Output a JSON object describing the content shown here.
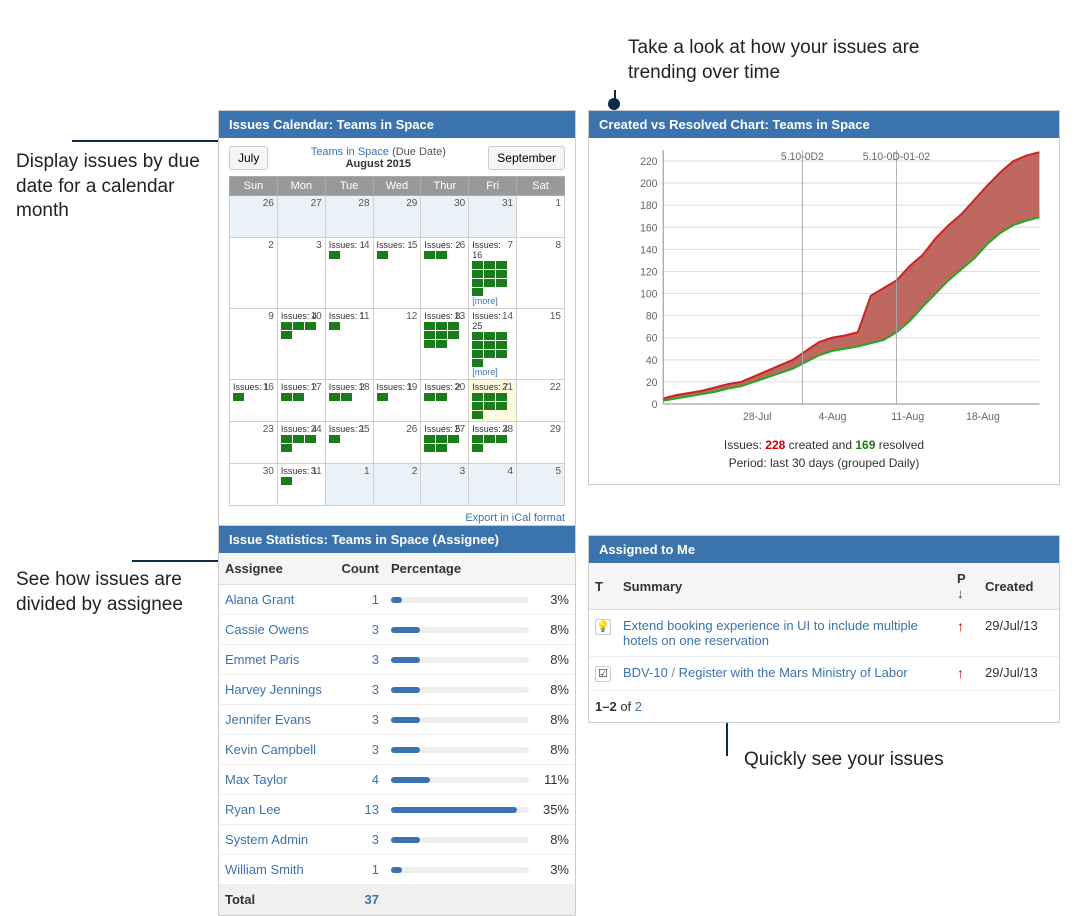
{
  "annotations": {
    "a1": "Display issues by due date for a calendar month",
    "a2": "Take a look at how your issues are trending over time",
    "a3": "See how issues are divided by assignee",
    "a4": "Quickly see your issues"
  },
  "calendar": {
    "header": "Issues Calendar: Teams in Space",
    "project_link": "Teams in Space",
    "due_label": "(Due Date)",
    "month": "August 2015",
    "prev_btn": "July",
    "next_btn": "September",
    "days": [
      "Sun",
      "Mon",
      "Tue",
      "Wed",
      "Thur",
      "Fri",
      "Sat"
    ],
    "export": "Export in iCal format",
    "weeks": [
      [
        {
          "n": 26,
          "o": 1
        },
        {
          "n": 27,
          "o": 1
        },
        {
          "n": 28,
          "o": 1
        },
        {
          "n": 29,
          "o": 1
        },
        {
          "n": 30,
          "o": 1
        },
        {
          "n": 31,
          "o": 1
        },
        {
          "n": 1
        }
      ],
      [
        {
          "n": 2
        },
        {
          "n": 3
        },
        {
          "n": 4,
          "c": 1
        },
        {
          "n": 5,
          "c": 1
        },
        {
          "n": 6,
          "c": 2
        },
        {
          "n": 7,
          "c": 16,
          "more": 1
        },
        {
          "n": 8
        }
      ],
      [
        {
          "n": 9
        },
        {
          "n": 10,
          "c": 4
        },
        {
          "n": 11,
          "c": 1
        },
        {
          "n": 12
        },
        {
          "n": 13,
          "c": 8
        },
        {
          "n": 14,
          "c": 25,
          "more": 1
        },
        {
          "n": 15
        }
      ],
      [
        {
          "n": 16,
          "c": 1
        },
        {
          "n": 17,
          "c": 2
        },
        {
          "n": 18,
          "c": 2
        },
        {
          "n": 19,
          "c": 1
        },
        {
          "n": 20,
          "c": 2
        },
        {
          "n": 21,
          "c": 7,
          "today": 1
        },
        {
          "n": 22
        }
      ],
      [
        {
          "n": 23
        },
        {
          "n": 24,
          "c": 4
        },
        {
          "n": 25,
          "c": 1
        },
        {
          "n": 26
        },
        {
          "n": 27,
          "c": 5
        },
        {
          "n": 28,
          "c": 4
        },
        {
          "n": 29
        }
      ],
      [
        {
          "n": 30
        },
        {
          "n": 31,
          "c": 1
        },
        {
          "n": 1,
          "o": 1
        },
        {
          "n": 2,
          "o": 1
        },
        {
          "n": 3,
          "o": 1
        },
        {
          "n": 4,
          "o": 1
        },
        {
          "n": 5,
          "o": 1
        }
      ]
    ],
    "issues_prefix": "Issues: ",
    "more_label": "[more]"
  },
  "chart": {
    "header": "Created vs Resolved Chart: Teams in Space",
    "yticks": [
      0,
      20,
      40,
      60,
      80,
      100,
      120,
      140,
      160,
      180,
      200,
      220
    ],
    "xticks": [
      "28-Jul",
      "4-Aug",
      "11-Aug",
      "18-Aug"
    ],
    "labels": [
      "5.10-0D2",
      "5.10-0D-01-02"
    ],
    "summary_prefix": "Issues: ",
    "created_n": "228",
    "summary_mid": " created and ",
    "resolved_n": "169",
    "summary_suffix": " resolved",
    "period": "Period: last 30 days (grouped Daily)"
  },
  "chart_data": {
    "type": "area",
    "xlabel": "",
    "ylabel": "",
    "ylim": [
      0,
      230
    ],
    "xticks": [
      "28-Jul",
      "4-Aug",
      "11-Aug",
      "18-Aug"
    ],
    "series": [
      {
        "name": "created",
        "color": "#c22",
        "values": [
          5,
          8,
          10,
          12,
          15,
          18,
          20,
          25,
          30,
          35,
          40,
          48,
          56,
          60,
          62,
          65,
          98,
          105,
          112,
          125,
          135,
          150,
          162,
          172,
          185,
          198,
          210,
          220,
          225,
          228
        ]
      },
      {
        "name": "resolved",
        "color": "#2a2",
        "values": [
          3,
          5,
          7,
          9,
          11,
          14,
          16,
          20,
          24,
          28,
          32,
          38,
          44,
          48,
          50,
          52,
          55,
          58,
          65,
          75,
          88,
          100,
          112,
          122,
          132,
          145,
          155,
          162,
          166,
          169
        ]
      }
    ],
    "annotations": [
      "5.10-0D2",
      "5.10-0D-01-02"
    ]
  },
  "stats": {
    "header": "Issue Statistics: Teams in Space (Assignee)",
    "cols": {
      "assignee": "Assignee",
      "count": "Count",
      "pct": "Percentage"
    },
    "rows": [
      {
        "name": "Alana Grant",
        "count": 1,
        "pct": "3%"
      },
      {
        "name": "Cassie Owens",
        "count": 3,
        "pct": "8%"
      },
      {
        "name": "Emmet Paris",
        "count": 3,
        "pct": "8%"
      },
      {
        "name": "Harvey Jennings",
        "count": 3,
        "pct": "8%"
      },
      {
        "name": "Jennifer Evans",
        "count": 3,
        "pct": "8%"
      },
      {
        "name": "Kevin Campbell",
        "count": 3,
        "pct": "8%"
      },
      {
        "name": "Max Taylor",
        "count": 4,
        "pct": "11%"
      },
      {
        "name": "Ryan Lee",
        "count": 13,
        "pct": "35%"
      },
      {
        "name": "System Admin",
        "count": 3,
        "pct": "8%"
      },
      {
        "name": "William Smith",
        "count": 1,
        "pct": "3%"
      }
    ],
    "total_label": "Total",
    "total_count": 37
  },
  "assigned": {
    "header": "Assigned to Me",
    "cols": {
      "t": "T",
      "summary": "Summary",
      "p": "P",
      "created": "Created"
    },
    "rows": [
      {
        "type": "💡",
        "type_name": "improvement",
        "summary": "Extend booking experience in UI to include multiple hotels on one reservation",
        "created": "29/Jul/13"
      },
      {
        "type": "☑",
        "type_name": "task",
        "key": "BDV-10",
        "sep": " / ",
        "summary": "Register with the Mars Ministry of Labor",
        "created": "29/Jul/13"
      }
    ],
    "pager": {
      "range": "1–2",
      "of": " of ",
      "total": "2"
    }
  }
}
